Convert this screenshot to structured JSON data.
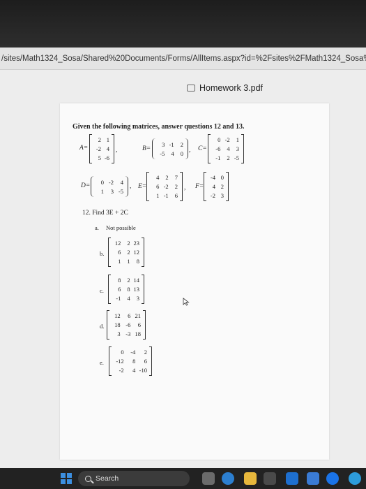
{
  "browser": {
    "url": "/sites/Math1324_Sosa/Shared%20Documents/Forms/AllItems.aspx?id=%2Fsites%2FMath1324_Sosa%2FShared%"
  },
  "document": {
    "title": "Homework 3.pdf"
  },
  "worksheet": {
    "instruction": "Given the following matrices, answer questions 12 and 13.",
    "matrices": [
      {
        "label": "A=",
        "rows": [
          [
            "2",
            "1"
          ],
          [
            "-2",
            "4"
          ],
          [
            "5",
            "-6"
          ]
        ],
        "punct": ","
      },
      {
        "label": "B=",
        "rows": [
          [
            "3",
            "-1",
            "2"
          ],
          [
            "-5",
            "4",
            "0"
          ]
        ],
        "punct": ","
      },
      {
        "label": "C=",
        "rows": [
          [
            "0",
            "-2",
            "1"
          ],
          [
            "-6",
            "4",
            "3"
          ],
          [
            "-1",
            "2",
            "-5"
          ]
        ],
        "punct": ""
      },
      {
        "label": "D=",
        "rows": [
          [
            "0",
            "-2",
            "4"
          ],
          [
            "1",
            "3",
            "-5"
          ]
        ],
        "punct": ","
      },
      {
        "label": "E=",
        "rows": [
          [
            "4",
            "2",
            "7"
          ],
          [
            "6",
            "-2",
            "2"
          ],
          [
            "1",
            "-1",
            "6"
          ]
        ],
        "punct": ","
      },
      {
        "label": "F=",
        "rows": [
          [
            "-4",
            "0"
          ],
          [
            "4",
            "2"
          ],
          [
            "-2",
            "3"
          ]
        ],
        "punct": ""
      }
    ],
    "question": "12. Find 3E + 2C",
    "options": [
      {
        "letter": "a.",
        "text": "Not possible"
      },
      {
        "letter": "b.",
        "rows": [
          [
            "12",
            "2",
            "23"
          ],
          [
            "6",
            "2",
            "12"
          ],
          [
            "1",
            "1",
            "8"
          ]
        ]
      },
      {
        "letter": "c.",
        "rows": [
          [
            "8",
            "2",
            "14"
          ],
          [
            "6",
            "8",
            "13"
          ],
          [
            "-1",
            "4",
            "3"
          ]
        ]
      },
      {
        "letter": "d.",
        "rows": [
          [
            "12",
            "6",
            "21"
          ],
          [
            "18",
            "-6",
            "6"
          ],
          [
            "3",
            "-3",
            "18"
          ]
        ]
      },
      {
        "letter": "e.",
        "rows": [
          [
            "0",
            "-4",
            "2"
          ],
          [
            "-12",
            "8",
            "6"
          ],
          [
            "-2",
            "4",
            "-10"
          ]
        ]
      }
    ]
  },
  "taskbar": {
    "search_placeholder": "Search"
  }
}
